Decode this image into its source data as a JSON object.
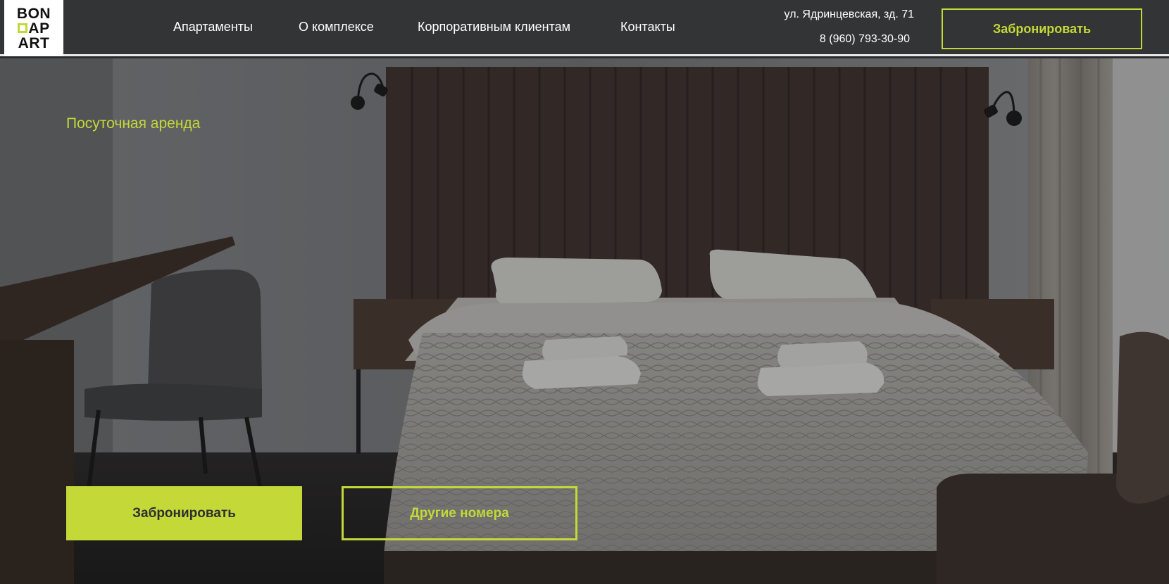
{
  "header": {
    "logo": {
      "line1": "BON",
      "line2": "AP",
      "line3": "ART"
    },
    "nav": [
      {
        "label": "Апартаменты"
      },
      {
        "label": "О комплексе"
      },
      {
        "label": "Корпоративным клиентам"
      },
      {
        "label": "Контакты"
      }
    ],
    "address": "ул. Ядринцевская, зд. 71",
    "phone": "8 (960) 793-30-90",
    "book_label": "Забронировать"
  },
  "hero": {
    "subtitle": "Посуточная аренда",
    "primary_button": "Забронировать",
    "secondary_button": "Другие номера",
    "background_image": "hotel-bedroom-photo"
  },
  "colors": {
    "accent": "#c4d938",
    "header_bg": "#333435",
    "text_light": "#ffffff",
    "button_text_dark": "#2f2f2f"
  }
}
